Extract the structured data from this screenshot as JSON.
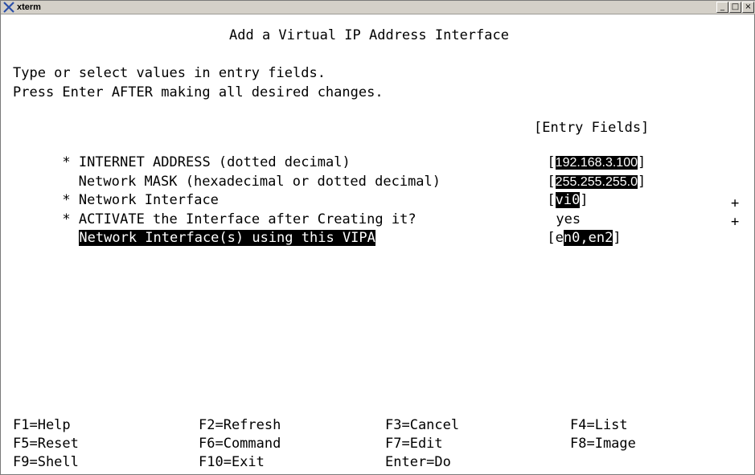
{
  "window": {
    "title": "xterm",
    "buttons": {
      "minimize": "_",
      "maximize": "□",
      "close": "×"
    }
  },
  "screen": {
    "heading": "Add a Virtual IP Address Interface",
    "instructions": [
      "Type or select values in entry fields.",
      "Press Enter AFTER making all desired changes."
    ],
    "entry_fields_header": "[Entry Fields]",
    "fields": [
      {
        "marker": "*",
        "label": "INTERNET ADDRESS (dotted decimal)",
        "open": "[",
        "value": "192.168.3.100",
        "close": "]",
        "suffix": ""
      },
      {
        "marker": "",
        "label": "Network MASK (hexadecimal or dotted decimal)",
        "open": "[",
        "value": "255.255.255.0",
        "close": "]",
        "suffix": ""
      },
      {
        "marker": "*",
        "label": "Network Interface",
        "open": "[",
        "value": "vi0",
        "close": "]",
        "suffix": ""
      },
      {
        "marker": "*",
        "label": "ACTIVATE the Interface after Creating it?",
        "open": "",
        "value": "yes",
        "close": "",
        "suffix": "+"
      },
      {
        "marker": "",
        "label": "Network Interface(s) using this VIPA",
        "open": "[",
        "value_prefix": "e",
        "value": "n0,en2",
        "close": "]",
        "suffix": "+"
      }
    ]
  },
  "function_keys": [
    [
      "F1=Help",
      "F2=Refresh",
      "F3=Cancel",
      "F4=List"
    ],
    [
      "F5=Reset",
      "F6=Command",
      "F7=Edit",
      "F8=Image"
    ],
    [
      "F9=Shell",
      "F10=Exit",
      "Enter=Do",
      ""
    ]
  ],
  "colors": {
    "text": "#000000",
    "background": "#ffffff",
    "highlight_bg": "#000000",
    "highlight_fg": "#ffffff",
    "titlebar": "#d4d0c8"
  }
}
